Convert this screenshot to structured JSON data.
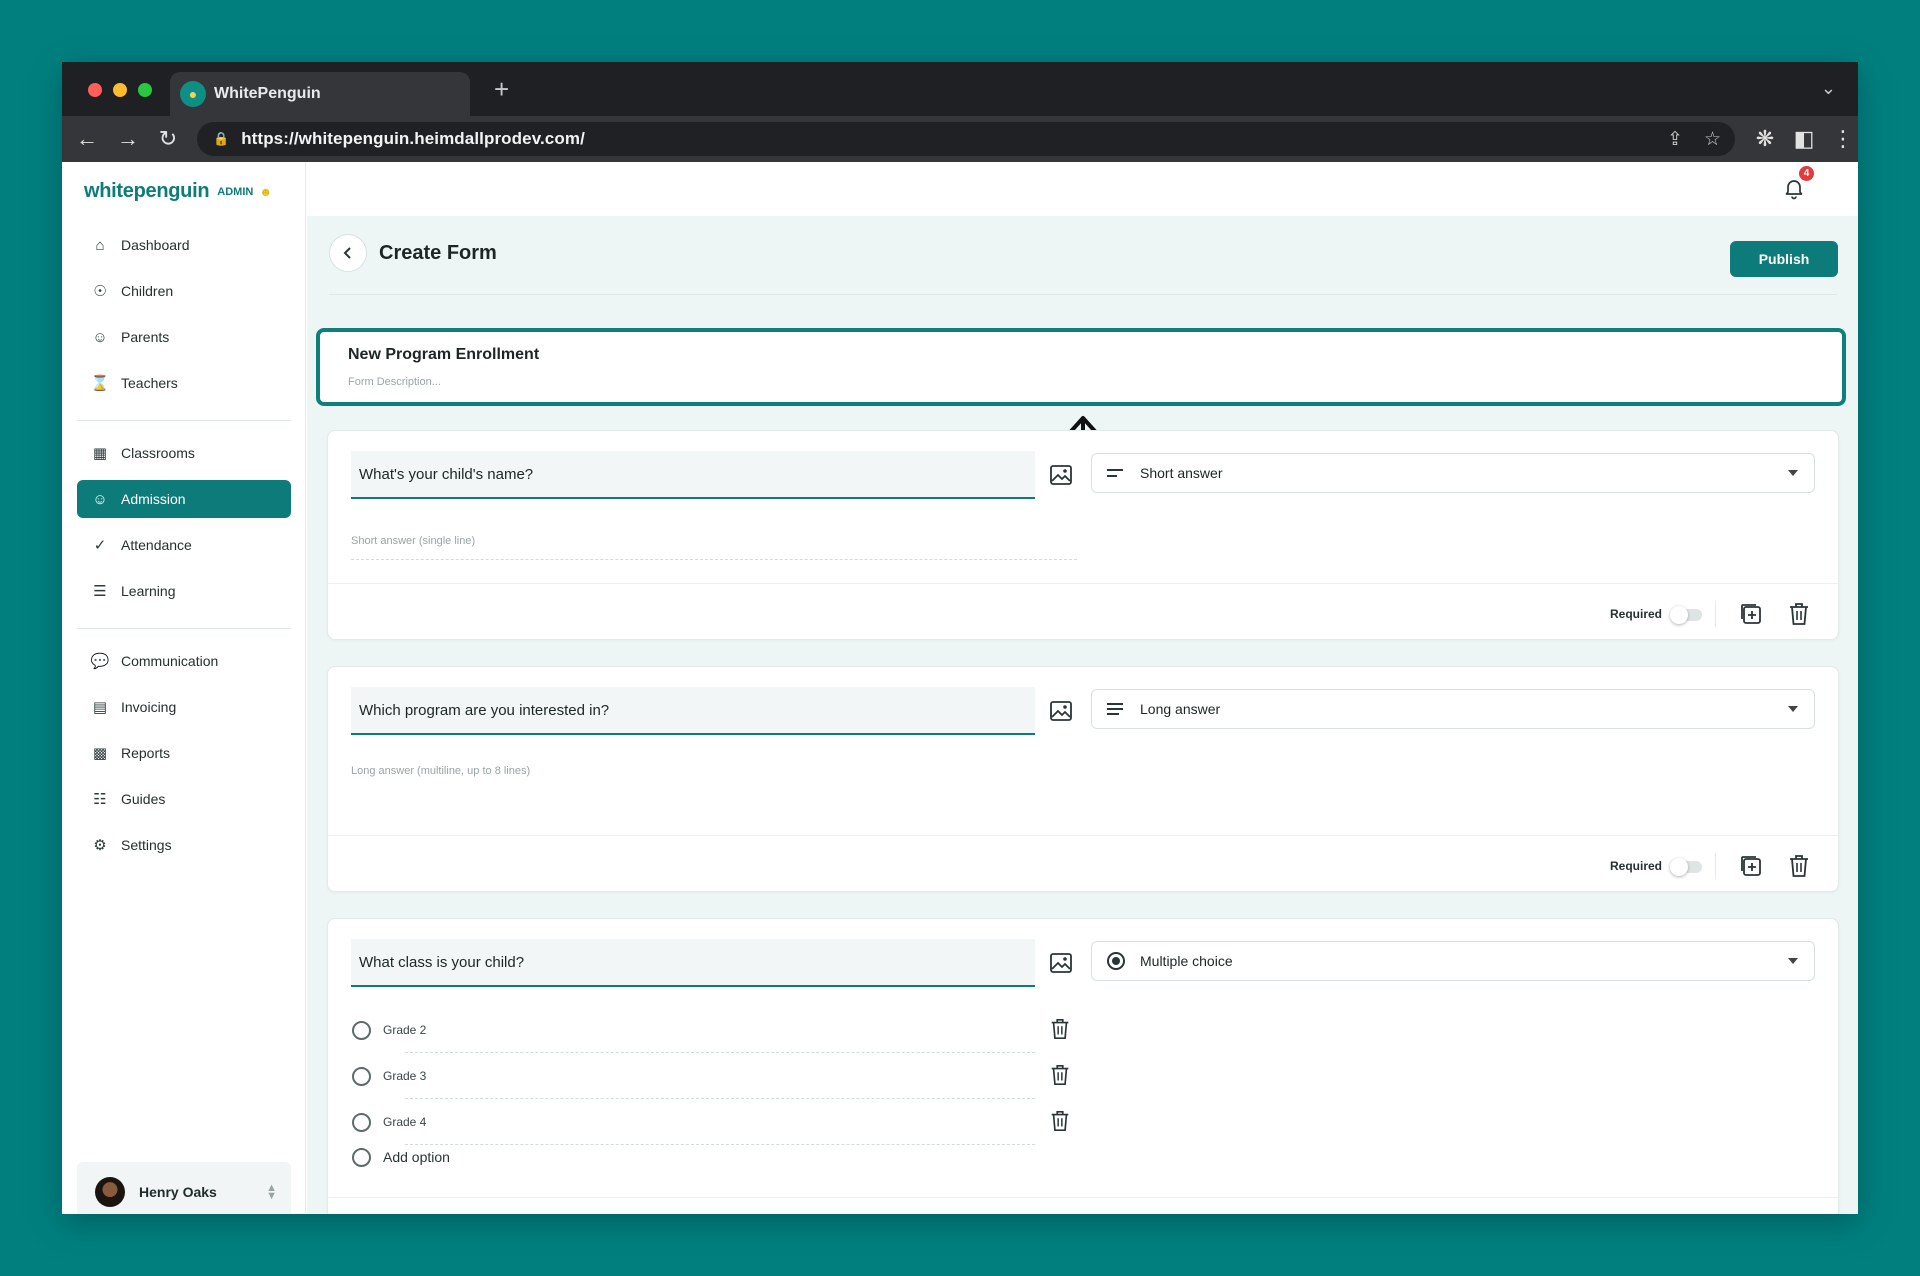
{
  "browser": {
    "tab_title": "WhitePenguin",
    "new_tab": "+",
    "url": "https://whitepenguin.heimdallprodev.com/"
  },
  "sidebar": {
    "logo": "whitepenguin",
    "logo_badge": "ADMIN",
    "groups": [
      [
        {
          "label": "Dashboard",
          "icon": "home-icon"
        },
        {
          "label": "Children",
          "icon": "child-icon"
        },
        {
          "label": "Parents",
          "icon": "users-icon"
        },
        {
          "label": "Teachers",
          "icon": "teacher-icon"
        }
      ],
      [
        {
          "label": "Classrooms",
          "icon": "grid-icon"
        },
        {
          "label": "Admission",
          "icon": "admission-icon",
          "active": true
        },
        {
          "label": "Attendance",
          "icon": "check-icon"
        },
        {
          "label": "Learning",
          "icon": "learning-icon"
        }
      ],
      [
        {
          "label": "Communication",
          "icon": "chat-icon"
        },
        {
          "label": "Invoicing",
          "icon": "invoice-icon"
        },
        {
          "label": "Reports",
          "icon": "chart-icon"
        },
        {
          "label": "Guides",
          "icon": "book-icon"
        },
        {
          "label": "Settings",
          "icon": "gear-icon"
        }
      ]
    ],
    "user": {
      "name": "Henry Oaks"
    }
  },
  "header": {
    "notification_count": "4"
  },
  "page": {
    "title": "Create Form",
    "publish_label": "Publish"
  },
  "form": {
    "title": "New Program Enrollment",
    "description_placeholder": "Form Description..."
  },
  "questions": [
    {
      "question": "What's your child's name?",
      "type": "Short answer",
      "hint": "Short answer (single line)",
      "required_label": "Required",
      "required": false
    },
    {
      "question": "Which program are you interested in?",
      "type": "Long answer",
      "hint": "Long answer (multiline, up to 8 lines)",
      "required_label": "Required",
      "required": false
    },
    {
      "question": "What class is your child?",
      "type": "Multiple choice",
      "options": [
        "Grade 2",
        "Grade 3",
        "Grade 4"
      ],
      "add_option": "Add option"
    }
  ],
  "colors": {
    "background": "#007f7f",
    "accent": "#0e7b7b",
    "badge": "#e33b3b"
  }
}
